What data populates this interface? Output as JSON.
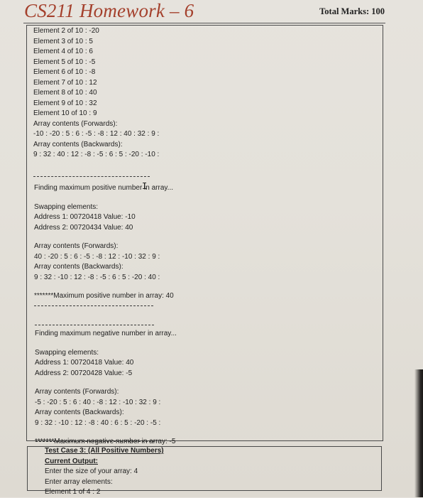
{
  "document": {
    "title": "CS211 Homework – 6",
    "total_marks": "Total Marks: 100"
  },
  "colors": {
    "title": "#a4402c",
    "paper": "#e4e1da",
    "text": "#1e1e1e"
  },
  "section1": {
    "elements": [
      "Element 2 of 10 : -20",
      "Element 3 of 10 : 5",
      "Element 4 of 10 : 6",
      "Element 5 of 10 : -5",
      "Element 6 of 10 : -8",
      "Element 7 of 10 : 12",
      "Element 8 of 10 : 40",
      "Element 9 of 10 : 32",
      "Element 10 of 10 : 9"
    ],
    "forwards_label": "Array contents (Forwards):",
    "forwards_values": "-10 : -20 : 5 : 6 : -5 : -8 : 12 : 40 : 32 : 9 :",
    "backwards_label": "Array contents (Backwards):",
    "backwards_values": "9 : 32 : 40 : 12 : -8 : -5 : 6 : 5 : -20 : -10 :"
  },
  "section2": {
    "heading": "Finding maximum positive number in array...",
    "swapping_label": "Swapping elements:",
    "address1": "Address 1: 00720418 Value: -10",
    "address2": "Address 2: 00720434 Value: 40",
    "forwards_label": "Array contents (Forwards):",
    "forwards_values": "40 : -20 : 5 : 6 : -5 : -8 : 12 : -10 : 32 : 9 :",
    "backwards_label": "Array contents (Backwards):",
    "backwards_values": "9 : 32 : -10 : 12 : -8 : -5 : 6 : 5 : -20 : 40 :",
    "result": "*******Maximum positive number in array: 40"
  },
  "section3": {
    "heading": "Finding maximum negative number in array...",
    "swapping_label": "Swapping elements:",
    "address1": "Address 1: 00720418 Value: 40",
    "address2": "Address 2: 00720428 Value: -5",
    "forwards_label": "Array contents (Forwards):",
    "forwards_values": "-5 : -20 : 5 : 6 : 40 : -8 : 12 : -10 : 32 : 9 :",
    "backwards_label": "Array contents (Backwards):",
    "backwards_values": "9 : 32 : -10 : 12 : -8 : 40 : 6 : 5 : -20 : -5 :",
    "result": "*******Maximum negative number in array: -5"
  },
  "test_case": {
    "title": "Test Case 3: (All Positive Numbers)",
    "current_output_label": "Current Output:",
    "prompt_size": "Enter the size of your array: 4",
    "prompt_elements": "Enter array elements:",
    "element1": "Element 1 of 4 : 2"
  },
  "cursor": {
    "icon": "text-cursor-icon",
    "glyph": "I"
  }
}
